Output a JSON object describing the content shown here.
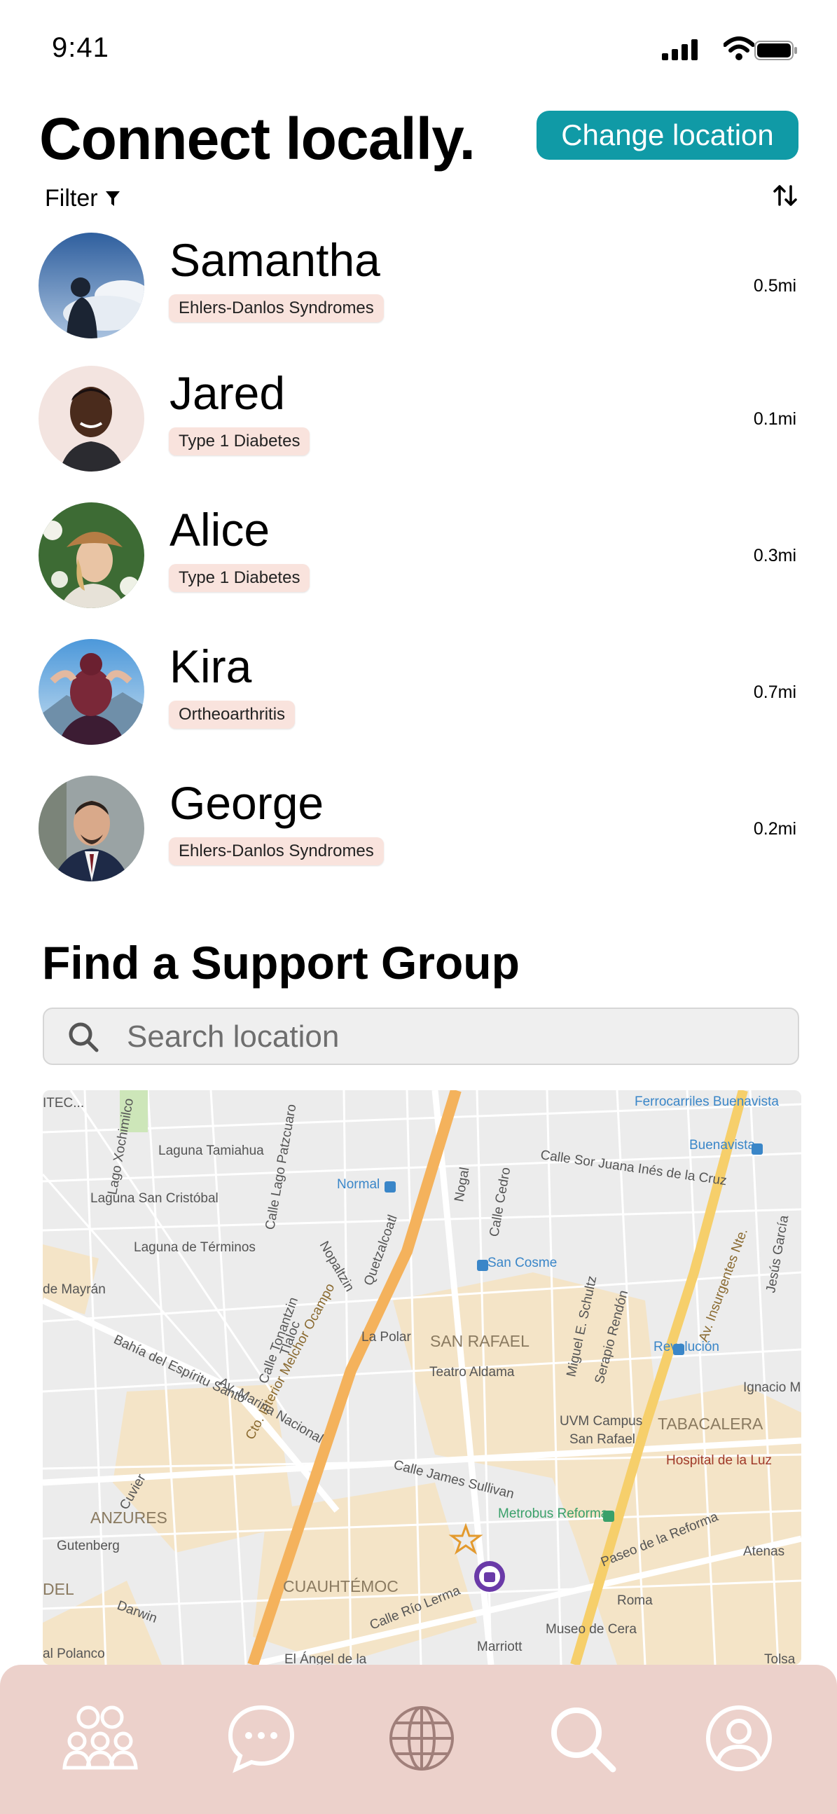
{
  "status_bar": {
    "time": "9:41"
  },
  "header": {
    "title": "Connect locally.",
    "change_location_label": "Change location"
  },
  "filter": {
    "label": "Filter"
  },
  "people": [
    {
      "name": "Samantha",
      "condition": "Ehlers-Danlos Syndromes",
      "distance": "0.5mi"
    },
    {
      "name": "Jared",
      "condition": "Type 1 Diabetes",
      "distance": "0.1mi"
    },
    {
      "name": "Alice",
      "condition": "Type 1 Diabetes",
      "distance": "0.3mi"
    },
    {
      "name": "Kira",
      "condition": "Ortheoarthritis",
      "distance": "0.7mi"
    },
    {
      "name": "George",
      "condition": "Ehlers-Danlos Syndromes",
      "distance": "0.2mi"
    }
  ],
  "support": {
    "title": "Find a Support Group",
    "search_placeholder": "Search location"
  },
  "map": {
    "labels": {
      "laguna_tamiahua": "Laguna Tamiahua",
      "laguna_san_cristobal": "Laguna San Cristóbal",
      "laguna_terminos": "Laguna de Términos",
      "normal": "Normal",
      "ferrocarriles": "Ferrocarriles Buenavista",
      "buenavista": "Buenavista",
      "sor_juana": "Calle Sor Juana Inés de la Cruz",
      "san_cosme": "San Cosme",
      "la_polar": "La Polar",
      "san_rafael": "SAN RAFAEL",
      "teatro_aldama": "Teatro Aldama",
      "revolucion": "Revolución",
      "uvm": "UVM Campus",
      "uvm2": "San Rafael",
      "tabacalera": "TABACALERA",
      "hospital": "Hospital de la Luz",
      "james_sullivan": "Calle James Sullivan",
      "metrobus": "Metrobus Reforma",
      "anzures": "ANZURES",
      "cuauhtemoc": "CUAUHTÉMOC",
      "museo": "Museo de Cera",
      "marriott": "Marriott",
      "angel": "El Ángel de la",
      "polanco": "al Polanco",
      "ocampo": "Cto. Interior Melchor Ocampo",
      "insurgentes": "Av. Insurgentes Nte.",
      "reforma": "Paseo de la Reforma",
      "roma": "Roma",
      "atenas": "Atenas",
      "marina": "Av. Marina Nacional",
      "gutenberg": "Gutenberg",
      "darwin": "Darwin",
      "cuvier": "Cuvier",
      "tolsa": "Tolsa",
      "ignacio": "Ignacio Ma",
      "mayran": "de Mayrán",
      "espiritu": "Bahía del Espíritu Santo",
      "rio_lerma": "Calle Río Lerma",
      "del": "DEL",
      "nogal": "Nogal",
      "cedro": "Calle Cedro",
      "nopaltzin": "Nopaltzin",
      "quetzalcoatl": "Quetzalcoatl",
      "tlaloc": "Tlaloc",
      "tonantzin": "Calle Tonantzin",
      "serapio": "Serapio Rendón",
      "schultz": "Miguel E. Schultz",
      "jesus_garcia": "Jesús García",
      "patzcuaro": "Calle Lago Patzcuaro",
      "xochimilco": "Lago Xochimilco",
      "itec": "ITEC..."
    }
  },
  "nav": {
    "items": [
      "community",
      "messages",
      "globe",
      "search",
      "profile"
    ]
  },
  "colors": {
    "accent": "#109aa6",
    "tag_bg": "#f9e3dd",
    "nav_bg": "#ecd1cb"
  }
}
